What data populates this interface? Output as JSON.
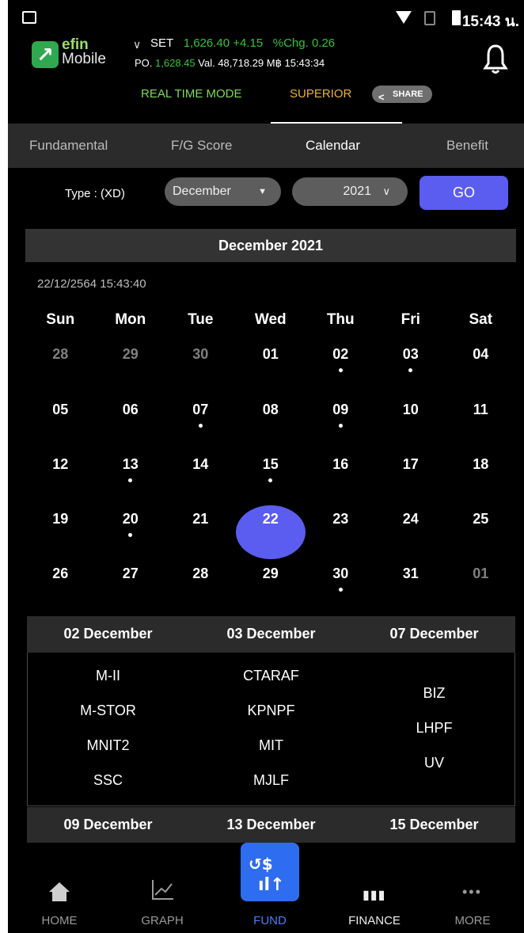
{
  "status_bar": {
    "time": "15:43 น."
  },
  "header": {
    "logo_e": "efin",
    "logo_m": "Mobile",
    "index_name": "SET",
    "index_value": "1,626.40",
    "index_change": "+4.15",
    "pct_label": "%Chg.",
    "pct_value": "0.26",
    "po_label": "PO.",
    "po_value": "1,628.45",
    "val_label": "Val.",
    "val_value": "48,718.29 M฿ 15:43:34",
    "realtime_label": "REAL TIME MODE",
    "superior_label": "SUPERIOR",
    "share_label": "SHARE"
  },
  "tabs": [
    {
      "label": "Fundamental",
      "active": false
    },
    {
      "label": "F/G Score",
      "active": false
    },
    {
      "label": "Calendar",
      "active": true
    },
    {
      "label": "Benefit",
      "active": false
    }
  ],
  "filter": {
    "type_label": "Type : (XD)",
    "month_value": "December",
    "year_value": "2021",
    "go_label": "GO"
  },
  "calendar": {
    "title": "December 2021",
    "timestamp": "22/12/2564 15:43:40",
    "weekdays": [
      "Sun",
      "Mon",
      "Tue",
      "Wed",
      "Thu",
      "Fri",
      "Sat"
    ],
    "weeks": [
      [
        {
          "d": "28",
          "dim": true
        },
        {
          "d": "29",
          "dim": true
        },
        {
          "d": "30",
          "dim": true
        },
        {
          "d": "01"
        },
        {
          "d": "02",
          "dot": true
        },
        {
          "d": "03",
          "dot": true
        },
        {
          "d": "04"
        }
      ],
      [
        {
          "d": "05"
        },
        {
          "d": "06"
        },
        {
          "d": "07",
          "dot": true
        },
        {
          "d": "08"
        },
        {
          "d": "09",
          "dot": true
        },
        {
          "d": "10"
        },
        {
          "d": "11"
        }
      ],
      [
        {
          "d": "12"
        },
        {
          "d": "13",
          "dot": true
        },
        {
          "d": "14"
        },
        {
          "d": "15",
          "dot": true
        },
        {
          "d": "16"
        },
        {
          "d": "17"
        },
        {
          "d": "18"
        }
      ],
      [
        {
          "d": "19"
        },
        {
          "d": "20",
          "dot": true
        },
        {
          "d": "21"
        },
        {
          "d": "22",
          "selected": true
        },
        {
          "d": "23"
        },
        {
          "d": "24"
        },
        {
          "d": "25"
        }
      ],
      [
        {
          "d": "26"
        },
        {
          "d": "27"
        },
        {
          "d": "28"
        },
        {
          "d": "29"
        },
        {
          "d": "30",
          "dot": true
        },
        {
          "d": "31"
        },
        {
          "d": "01",
          "dim": true
        }
      ]
    ]
  },
  "events": [
    {
      "columns": [
        {
          "date": "02 December",
          "items": [
            "M-II",
            "M-STOR",
            "MNIT2",
            "SSC"
          ]
        },
        {
          "date": "03 December",
          "items": [
            "CTARAF",
            "KPNPF",
            "MIT",
            "MJLF"
          ]
        },
        {
          "date": "07 December",
          "items": [
            "BIZ",
            "LHPF",
            "UV"
          ]
        }
      ]
    },
    {
      "columns": [
        {
          "date": "09 December",
          "items": []
        },
        {
          "date": "13 December",
          "items": []
        },
        {
          "date": "15 December",
          "items": []
        }
      ]
    }
  ],
  "nav": [
    {
      "label": "HOME",
      "icon": "home-icon"
    },
    {
      "label": "GRAPH",
      "icon": "graph-icon"
    },
    {
      "label": "FUND",
      "icon": "fund-icon",
      "active": true
    },
    {
      "label": "FINANCE",
      "icon": "finance-icon"
    },
    {
      "label": "MORE",
      "icon": "more-icon"
    }
  ]
}
